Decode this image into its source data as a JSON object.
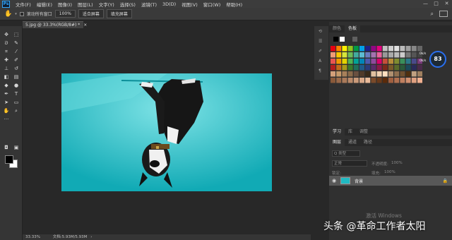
{
  "app": {
    "logo": "Ps",
    "window_controls": [
      "—",
      "□",
      "✕"
    ]
  },
  "menubar": {
    "items": [
      "文件(F)",
      "编辑(E)",
      "图像(I)",
      "图层(L)",
      "文字(Y)",
      "选择(S)",
      "滤镜(T)",
      "3D(D)",
      "视图(V)",
      "窗口(W)",
      "帮助(H)"
    ]
  },
  "options": {
    "scroll_all": "滚动所有窗口",
    "zoom": "100%",
    "fit_screen": "适合屏幕",
    "fill_screen": "填充屏幕",
    "search_icon": "search-icon"
  },
  "document": {
    "tab_title": "5.jpg @ 33.3%(RGB/8#) *",
    "close": "×"
  },
  "status": {
    "zoom": "33.33%",
    "doc_info": "文档:5.93M/5.93M",
    "arrow": "›"
  },
  "panels": {
    "top_tabs": [
      "颜色",
      "色板"
    ],
    "top_active": 1,
    "layer_tabs_top": [
      "学习",
      "库",
      "调整"
    ],
    "layer_tabs": [
      "图层",
      "通道",
      "路径"
    ],
    "kind_label": "Q 类型",
    "blend_mode": "正常",
    "opacity_label": "不透明度:",
    "opacity_value": "100%",
    "lock_label": "锁定:",
    "fill_label": "填充:",
    "fill_value": "100%",
    "layer_name": "背景"
  },
  "overlay": {
    "percent": "83",
    "badge_up": "0k/s",
    "badge_down": "0k/s",
    "watermark": "头条 @革命工作者太阳",
    "activate": "激活 Windows"
  },
  "colors": {
    "accent": "#31a8ff",
    "image_bg": "#20b9c2",
    "panel": "#303030",
    "canvas": "#282828"
  }
}
